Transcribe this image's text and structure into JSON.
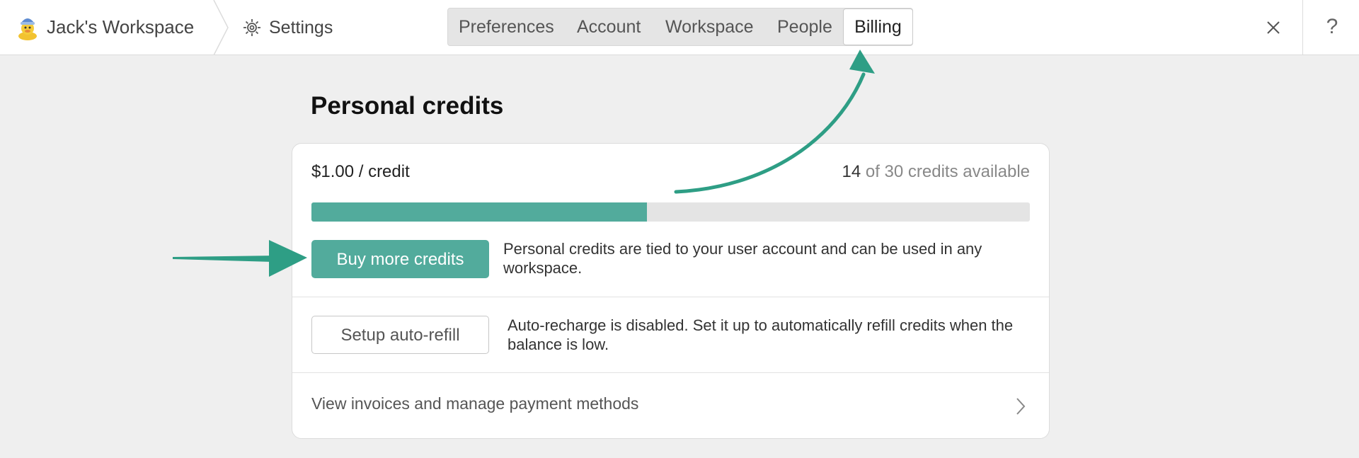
{
  "header": {
    "workspace_name": "Jack's Workspace",
    "settings_label": "Settings",
    "tabs": [
      {
        "label": "Preferences"
      },
      {
        "label": "Account"
      },
      {
        "label": "Workspace"
      },
      {
        "label": "People"
      },
      {
        "label": "Billing",
        "active": true
      }
    ],
    "close_icon": "close-icon",
    "help_label": "?"
  },
  "credits": {
    "title": "Personal credits",
    "price": "$1.00 / credit",
    "available_count": "14",
    "available_suffix": " of 30 credits available",
    "used_fraction": 0.467,
    "buy_label": "Buy more credits",
    "buy_description": "Personal credits are tied to your user account and can be used in any workspace.",
    "autorefill_label": "Setup auto-refill",
    "autorefill_description": "Auto-recharge is disabled. Set it up to automatically refill credits when the balance is low.",
    "invoices_label": "View invoices and manage payment methods"
  },
  "colors": {
    "accent": "#52ab9c",
    "arrow": "#2e9e85"
  }
}
